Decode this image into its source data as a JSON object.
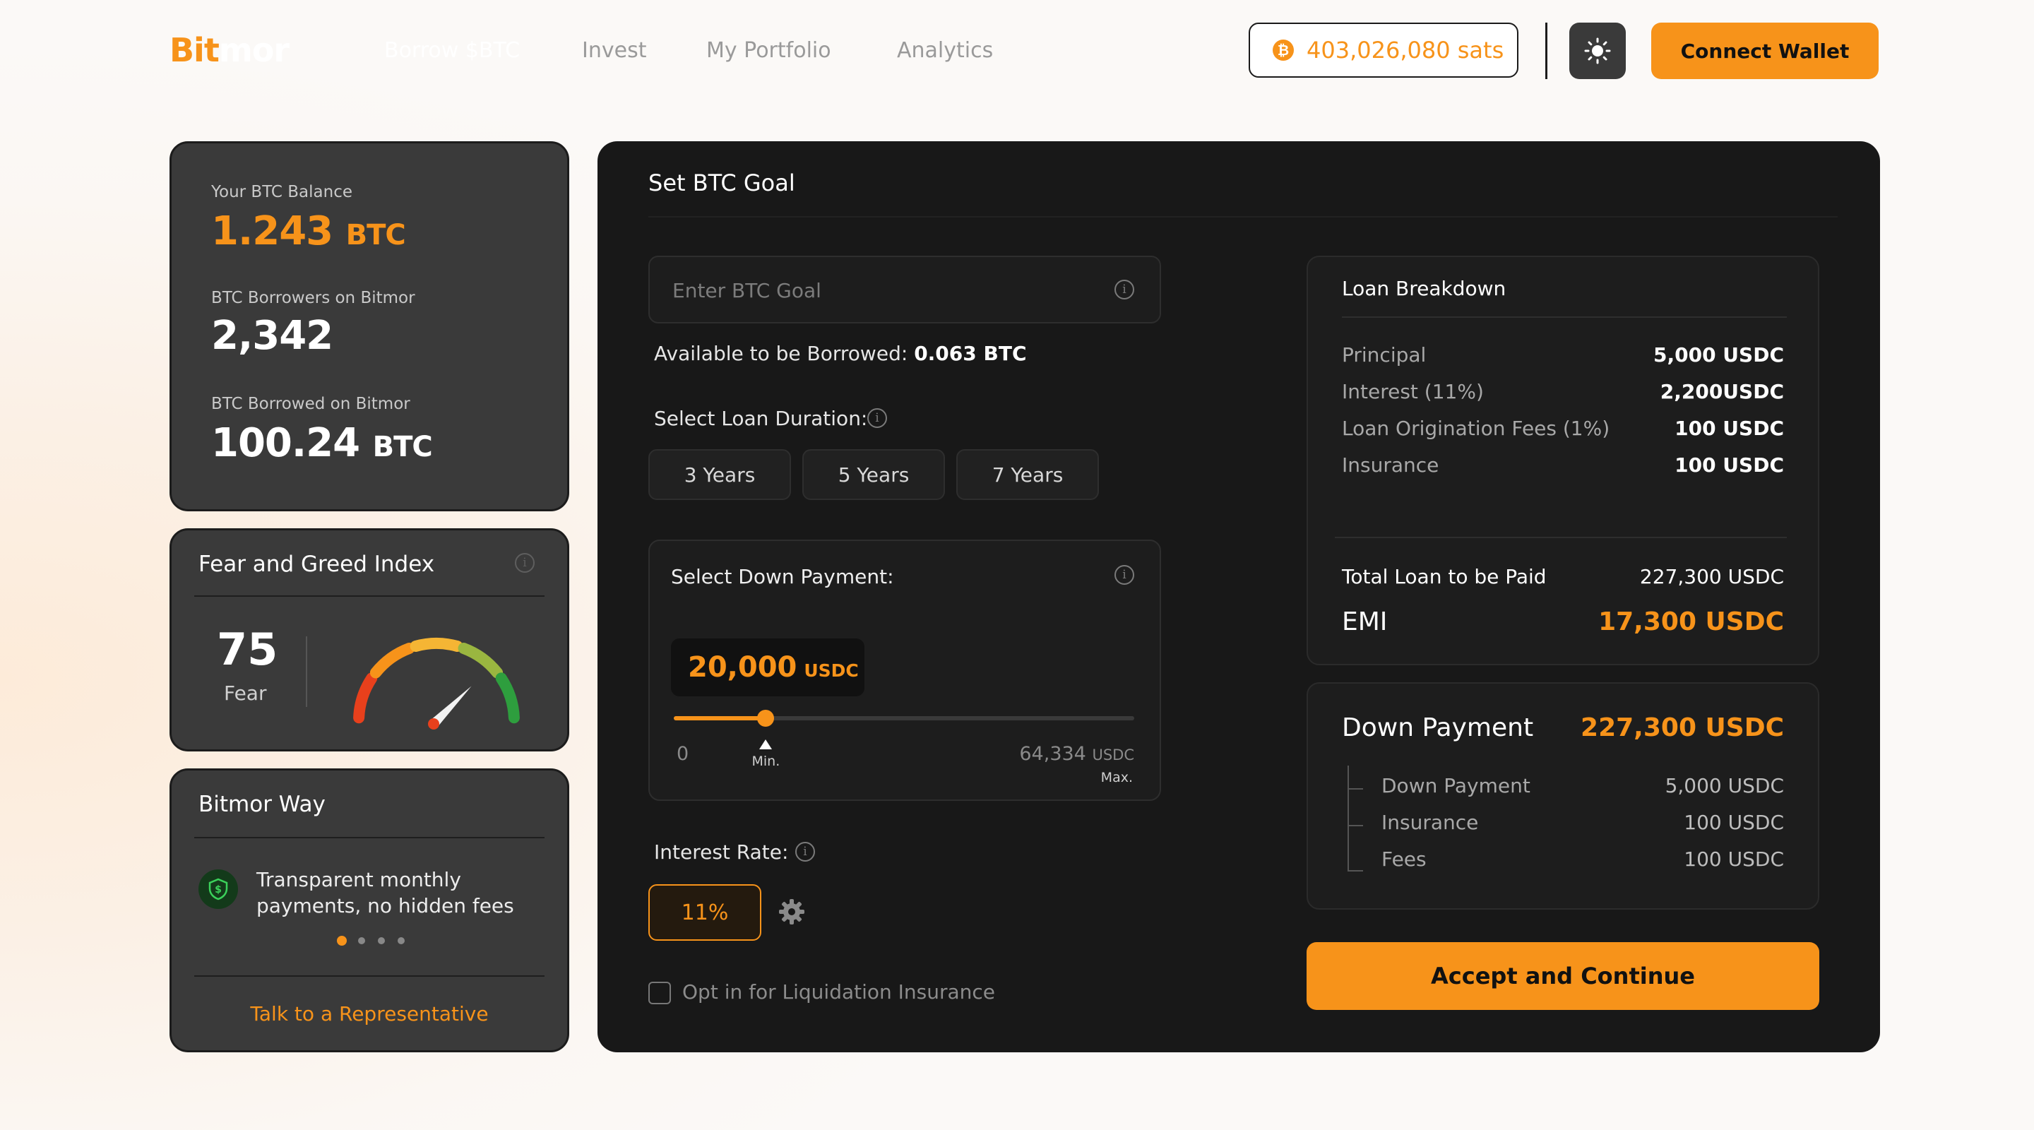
{
  "brand": {
    "part1": "Bit",
    "part2": "mor",
    "accent": "#f7931a"
  },
  "nav": {
    "items": [
      "Borrow $BTC",
      "Invest",
      "My Portfolio",
      "Analytics"
    ]
  },
  "header": {
    "sats_balance": "403,026,080 sats",
    "coin_symbol": "₿",
    "connect_label": "Connect Wallet"
  },
  "stats": {
    "balance_label": "Your BTC Balance",
    "balance_value": "1.243",
    "balance_unit": "BTC",
    "borrowers_label": "BTC Borrowers on Bitmor",
    "borrowers_value": "2,342",
    "borrowed_label": "BTC Borrowed on Bitmor",
    "borrowed_value": "100.24",
    "borrowed_unit": "BTC"
  },
  "fear_greed": {
    "title": "Fear and Greed Index",
    "value": "75",
    "label": "Fear",
    "gauge_level": 0.75,
    "gauge_colors": [
      "#e8401c",
      "#f7931a",
      "#f5b534",
      "#9ab640",
      "#2e9e3e"
    ]
  },
  "bitmor_way": {
    "title": "Bitmor Way",
    "feature_text": "Transparent monthly payments, no hidden fees",
    "active_slide": 0,
    "slide_count": 4,
    "cta": "Talk to a Representative"
  },
  "goal": {
    "title": "Set BTC Goal",
    "input_placeholder": "Enter BTC Goal",
    "available_label": "Available to be Borrowed:",
    "available_value": "0.063 BTC",
    "duration_label": "Select Loan Duration:",
    "durations": [
      "3 Years",
      "5 Years",
      "7 Years"
    ],
    "down_payment_label": "Select Down Payment:",
    "down_payment_value": "20,000",
    "down_payment_unit": "USDC",
    "slider_min": "0",
    "slider_max": "64,334",
    "slider_max_unit": "USDC",
    "slider_min_tag": "Min.",
    "slider_max_tag": "Max.",
    "slider_fraction": 0.2,
    "interest_label": "Interest Rate:",
    "interest_value": "11%",
    "insurance_optin": "Opt in for Liquidation Insurance",
    "insurance_checked": false
  },
  "loan_breakdown": {
    "title": "Loan Breakdown",
    "rows": [
      {
        "k": "Principal",
        "v": "5,000 USDC"
      },
      {
        "k": "Interest (11%)",
        "v": "2,200USDC"
      },
      {
        "k": "Loan Origination Fees (1%)",
        "v": "100 USDC"
      },
      {
        "k": "Insurance",
        "v": "100 USDC"
      }
    ],
    "total_label": "Total Loan to be Paid",
    "total_value": "227,300 USDC",
    "emi_label": "EMI",
    "emi_value": "17,300 USDC"
  },
  "down_payment_summary": {
    "title": "Down Payment",
    "value": "227,300 USDC",
    "rows": [
      {
        "k": "Down Payment",
        "v": "5,000 USDC"
      },
      {
        "k": "Insurance",
        "v": "100 USDC"
      },
      {
        "k": "Fees",
        "v": "100 USDC"
      }
    ]
  },
  "accept_label": "Accept and Continue"
}
